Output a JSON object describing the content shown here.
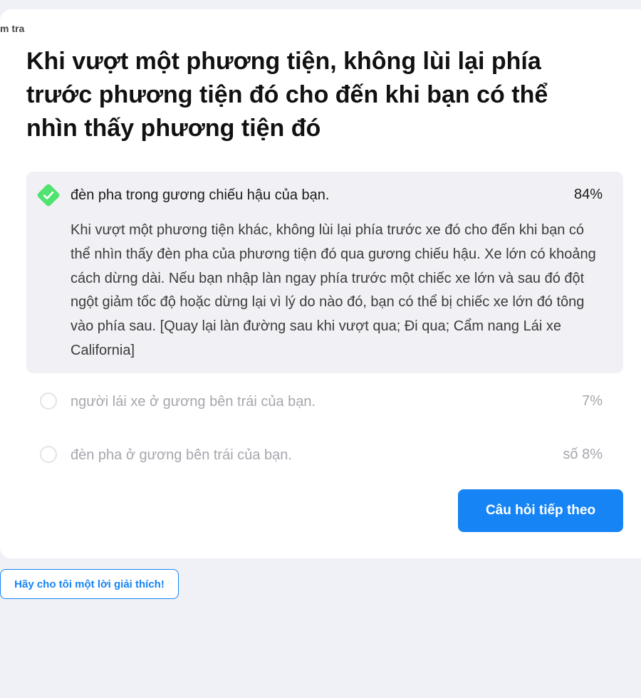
{
  "breadcrumb": "m tra",
  "question": "Khi vượt một phương tiện, không lùi lại phía trước phương tiện đó cho đến khi bạn có thể nhìn thấy phương tiện đó",
  "answers": [
    {
      "label": "đèn pha trong gương chiếu hậu của bạn.",
      "percent": "84%",
      "correct": true,
      "explanation": "Khi vượt một phương tiện khác, không lùi lại phía trước xe đó cho đến khi bạn có thể nhìn thấy đèn pha của phương tiện đó qua gương chiếu hậu. Xe lớn có khoảng cách dừng dài. Nếu bạn nhập làn ngay phía trước một chiếc xe lớn và sau đó đột ngột giảm tốc độ hoặc dừng lại vì lý do nào đó, bạn có thể bị chiếc xe lớn đó tông vào phía sau. [Quay lại làn đường sau khi vượt qua; Đi qua; Cẩm nang Lái xe California]"
    },
    {
      "label": "người lái xe ở gương bên trái của bạn.",
      "percent": "7%",
      "correct": false
    },
    {
      "label": "đèn pha ở gương bên trái của bạn.",
      "percent": "số 8%",
      "correct": false
    }
  ],
  "next_button": "Câu hỏi tiếp theo",
  "explain_button": "Hãy cho tôi một lời giải thích!",
  "colors": {
    "accent": "#1684f5",
    "correct_check": "#4fe36f",
    "background": "#f0f1f6"
  },
  "icons": {
    "correct": "check-diamond-icon",
    "unselected": "radio-empty-icon"
  }
}
